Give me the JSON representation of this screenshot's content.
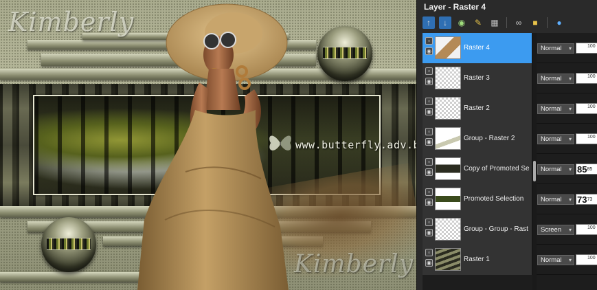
{
  "canvas": {
    "watermark_top": "Kimberly",
    "watermark_bottom": "Kimberly",
    "url_text": "www.butterfly.adv.br"
  },
  "layers_panel": {
    "title": "Layer - Raster 4",
    "toolbar": [
      {
        "icon": "new-layer-icon"
      },
      {
        "icon": "merge-down-icon"
      },
      {
        "icon": "visibility-icon"
      },
      {
        "icon": "edit-icon"
      },
      {
        "icon": "delete-layer-icon"
      },
      {
        "icon": "link-icon"
      },
      {
        "icon": "lock-icon"
      },
      {
        "icon": "properties-icon"
      }
    ],
    "layers": [
      {
        "name": "Raster 4",
        "blend": "Normal",
        "opacity": "100",
        "selected": true
      },
      {
        "name": "Raster 3",
        "blend": "Normal",
        "opacity": "100"
      },
      {
        "name": "Raster 2",
        "blend": "Normal",
        "opacity": "100"
      },
      {
        "name": "Group - Raster 2",
        "blend": "Normal",
        "opacity": "100"
      },
      {
        "name": "Copy of Promoted Se",
        "blend": "Normal",
        "opacity": "85",
        "opacity_small": "85"
      },
      {
        "name": "Promoted Selection",
        "blend": "Normal",
        "opacity": "73",
        "opacity_small": "73"
      },
      {
        "name": "Group - Group - Rast",
        "blend": "Screen",
        "opacity": "100"
      },
      {
        "name": "Raster 1",
        "blend": "Normal",
        "opacity": "100"
      }
    ]
  },
  "colors": {
    "selected_row": "#3c9bf0",
    "panel_bg": "#2a2a2a",
    "canvas_bg": "#a9ab8e"
  }
}
